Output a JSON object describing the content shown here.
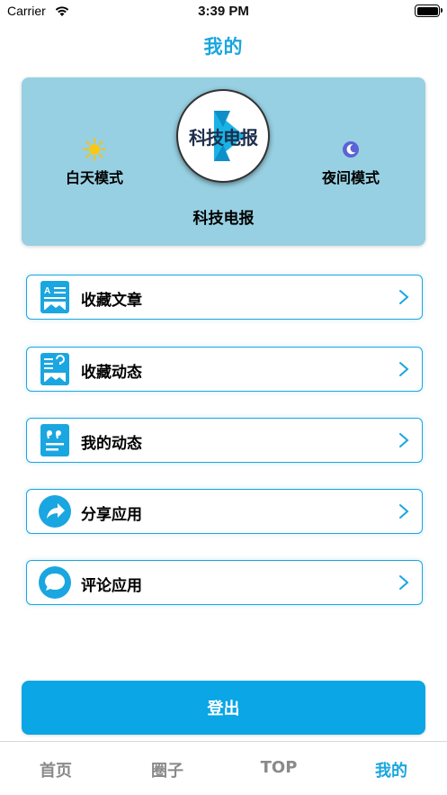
{
  "status_bar": {
    "carrier": "Carrier",
    "time": "3:39 PM"
  },
  "nav": {
    "title": "我的"
  },
  "profile": {
    "avatar_text": "科技电报",
    "day_mode": "白天模式",
    "night_mode": "夜间模式",
    "user_name": "科技电报"
  },
  "menu": {
    "items": [
      {
        "label": "收藏文章",
        "icon": "article-icon"
      },
      {
        "label": "收藏动态",
        "icon": "feed-icon"
      },
      {
        "label": "我的动态",
        "icon": "quote-icon"
      },
      {
        "label": "分享应用",
        "icon": "share-icon"
      },
      {
        "label": "评论应用",
        "icon": "comment-icon"
      }
    ]
  },
  "logout_label": "登出",
  "tabs": [
    {
      "label": "首页",
      "active": false
    },
    {
      "label": "圈子",
      "active": false
    },
    {
      "label": "TOP",
      "active": false
    },
    {
      "label": "我的",
      "active": true
    }
  ],
  "colors": {
    "accent": "#1aa6e0",
    "card": "#97d0e2",
    "logout": "#0aa6e6"
  }
}
